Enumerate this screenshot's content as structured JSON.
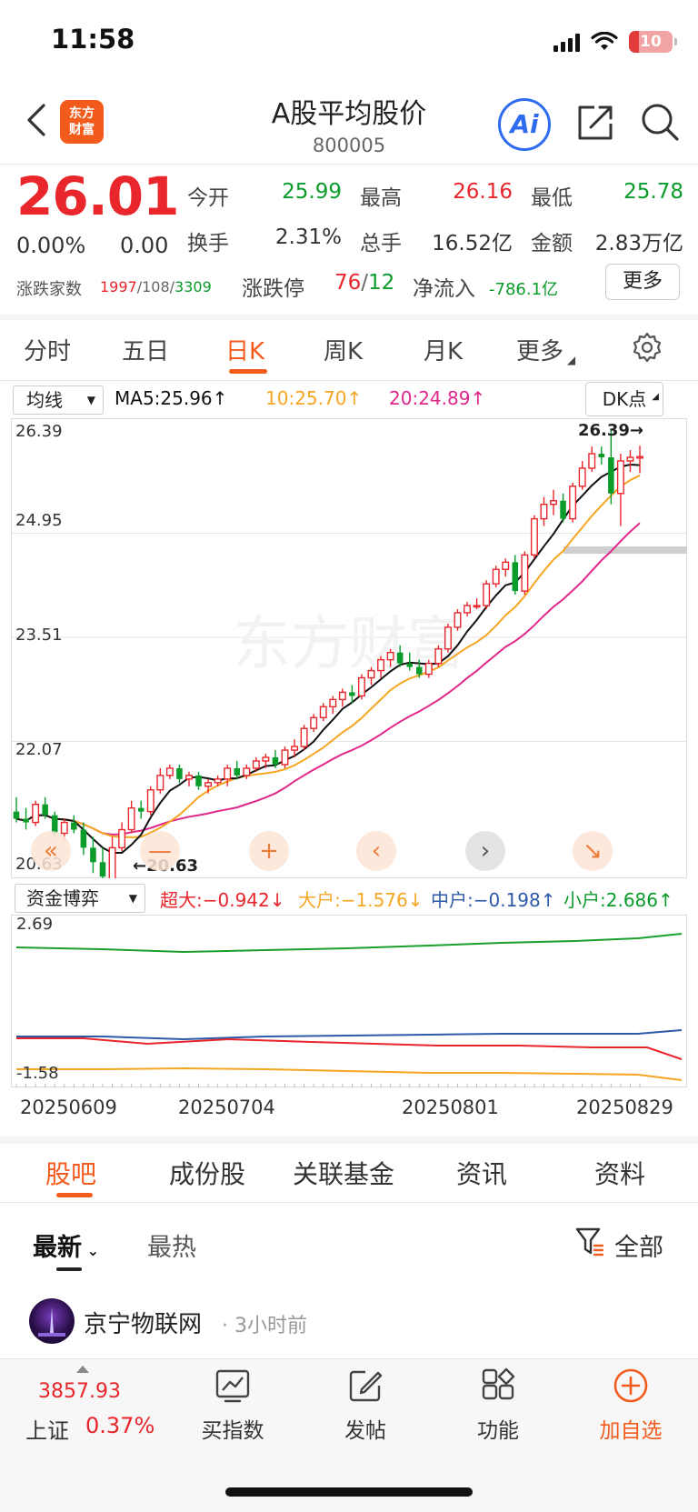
{
  "status": {
    "time": "11:58",
    "battery": "10"
  },
  "header": {
    "logo": [
      "东方",
      "财富"
    ],
    "title": "A股平均股价",
    "code": "800005",
    "ai_label": "Ai"
  },
  "quote": {
    "price": "26.01",
    "change_pct": "0.00%",
    "change": "0.00",
    "open_label": "今开",
    "open": "25.99",
    "high_label": "最高",
    "high": "26.16",
    "low_label": "最低",
    "low": "25.78",
    "turnover_label": "换手",
    "turnover": "2.31%",
    "volume_label": "总手",
    "volume": "16.52亿",
    "amount_label": "金额",
    "amount": "2.83万亿",
    "breadth_label": "涨跌家数",
    "breadth_up": "1997",
    "breadth_flat": "108",
    "breadth_down": "3309",
    "limit_label": "涨跌停",
    "limit_up": "76",
    "limit_down": "12",
    "inflow_label": "净流入",
    "inflow": "-786.1亿",
    "more_label": "更多"
  },
  "tabs": [
    "分时",
    "五日",
    "日K",
    "周K",
    "月K",
    "更多"
  ],
  "ma": {
    "select": "均线",
    "ma5": "MA5:25.96↑",
    "ma10": "10:25.70↑",
    "ma20": "20:24.89↑",
    "dk_label": "DK点"
  },
  "chart_data": {
    "type": "candlestick",
    "y_ticks": [
      "26.39",
      "24.95",
      "23.51",
      "22.07",
      "20.63"
    ],
    "ylim": [
      20.63,
      26.39
    ],
    "annot_high": "26.39→",
    "annot_low": "←20.63",
    "x_labels": [
      "20250609",
      "20250704",
      "20250801",
      "20250829"
    ],
    "candles": [
      [
        21.1,
        21.3,
        20.95,
        21.0
      ],
      [
        21.0,
        21.15,
        20.85,
        20.95
      ],
      [
        20.95,
        21.25,
        20.9,
        21.2
      ],
      [
        21.2,
        21.3,
        21.0,
        21.05
      ],
      [
        21.05,
        21.1,
        20.75,
        20.8
      ],
      [
        20.8,
        21.0,
        20.7,
        20.95
      ],
      [
        20.95,
        21.05,
        20.8,
        20.85
      ],
      [
        20.85,
        20.95,
        20.5,
        20.6
      ],
      [
        20.6,
        20.75,
        20.25,
        20.4
      ],
      [
        20.4,
        20.6,
        20.1,
        20.2
      ],
      [
        20.15,
        20.75,
        20.1,
        20.6
      ],
      [
        20.6,
        20.95,
        20.55,
        20.85
      ],
      [
        20.85,
        21.25,
        20.8,
        21.15
      ],
      [
        21.15,
        21.25,
        21.0,
        21.1
      ],
      [
        21.1,
        21.45,
        21.05,
        21.4
      ],
      [
        21.4,
        21.7,
        21.35,
        21.6
      ],
      [
        21.6,
        21.75,
        21.55,
        21.7
      ],
      [
        21.7,
        21.75,
        21.5,
        21.55
      ],
      [
        21.55,
        21.65,
        21.45,
        21.6
      ],
      [
        21.6,
        21.65,
        21.4,
        21.45
      ],
      [
        21.45,
        21.55,
        21.35,
        21.5
      ],
      [
        21.5,
        21.6,
        21.45,
        21.55
      ],
      [
        21.55,
        21.75,
        21.45,
        21.7
      ],
      [
        21.7,
        21.8,
        21.55,
        21.6
      ],
      [
        21.6,
        21.75,
        21.55,
        21.7
      ],
      [
        21.7,
        21.85,
        21.65,
        21.8
      ],
      [
        21.8,
        21.9,
        21.7,
        21.85
      ],
      [
        21.85,
        21.95,
        21.7,
        21.75
      ],
      [
        21.75,
        22.0,
        21.7,
        21.95
      ],
      [
        21.95,
        22.1,
        21.85,
        22.0
      ],
      [
        22.0,
        22.3,
        21.95,
        22.25
      ],
      [
        22.25,
        22.45,
        22.2,
        22.4
      ],
      [
        22.4,
        22.6,
        22.35,
        22.55
      ],
      [
        22.55,
        22.7,
        22.45,
        22.65
      ],
      [
        22.65,
        22.8,
        22.55,
        22.75
      ],
      [
        22.75,
        22.85,
        22.6,
        22.7
      ],
      [
        22.7,
        23.0,
        22.65,
        22.95
      ],
      [
        22.95,
        23.1,
        22.85,
        23.05
      ],
      [
        23.05,
        23.25,
        22.95,
        23.2
      ],
      [
        23.2,
        23.35,
        23.1,
        23.3
      ],
      [
        23.3,
        23.4,
        23.1,
        23.15
      ],
      [
        23.15,
        23.3,
        23.05,
        23.1
      ],
      [
        23.1,
        23.2,
        22.95,
        23.0
      ],
      [
        23.0,
        23.2,
        22.95,
        23.15
      ],
      [
        23.15,
        23.4,
        23.1,
        23.35
      ],
      [
        23.35,
        23.7,
        23.3,
        23.65
      ],
      [
        23.65,
        23.9,
        23.6,
        23.85
      ],
      [
        23.85,
        24.0,
        23.8,
        23.95
      ],
      [
        23.95,
        24.05,
        23.9,
        23.95
      ],
      [
        23.95,
        24.3,
        23.9,
        24.25
      ],
      [
        24.25,
        24.5,
        24.2,
        24.45
      ],
      [
        24.45,
        24.6,
        24.35,
        24.55
      ],
      [
        24.55,
        24.65,
        24.1,
        24.15
      ],
      [
        24.15,
        24.7,
        24.1,
        24.65
      ],
      [
        24.65,
        25.2,
        24.6,
        25.15
      ],
      [
        25.15,
        25.45,
        25.05,
        25.35
      ],
      [
        25.35,
        25.55,
        25.2,
        25.4
      ],
      [
        25.4,
        25.5,
        25.1,
        25.15
      ],
      [
        25.15,
        25.65,
        25.1,
        25.6
      ],
      [
        25.6,
        25.95,
        25.55,
        25.85
      ],
      [
        25.85,
        26.15,
        25.8,
        26.05
      ],
      [
        26.05,
        26.15,
        25.9,
        26.0
      ],
      [
        26.0,
        26.39,
        25.35,
        25.5
      ],
      [
        25.5,
        26.05,
        25.05,
        25.95
      ],
      [
        25.95,
        26.1,
        25.8,
        26.0
      ],
      [
        25.99,
        26.16,
        25.78,
        26.01
      ]
    ]
  },
  "chart_tools": [
    "«",
    "—",
    "+",
    "‹",
    "›",
    "↘"
  ],
  "fund": {
    "select": "资金博弈",
    "super": "超大:−0.942↓",
    "large": "大户:−1.576↓",
    "mid": "中户:−0.198↑",
    "small": "小户:2.686↑",
    "ymax": "2.69",
    "ymin": "-1.58"
  },
  "section_tabs": [
    "股吧",
    "成份股",
    "关联基金",
    "资讯",
    "资料"
  ],
  "feed": {
    "sort_new": "最新",
    "sort_hot": "最热",
    "filter": "全部",
    "poster": "京宁物联网",
    "time": "· 3小时前"
  },
  "bottom_bar": {
    "index_value": "3857.93",
    "index_name": "上证",
    "index_pct": "0.37%",
    "items": [
      "买指数",
      "发帖",
      "功能",
      "加自选"
    ]
  },
  "colors": {
    "up": "#e8262b",
    "down": "#0a9c2a",
    "ma5": "#111111",
    "ma10": "#f5a623",
    "ma20": "#e0278a",
    "brand": "#f35b1c"
  }
}
